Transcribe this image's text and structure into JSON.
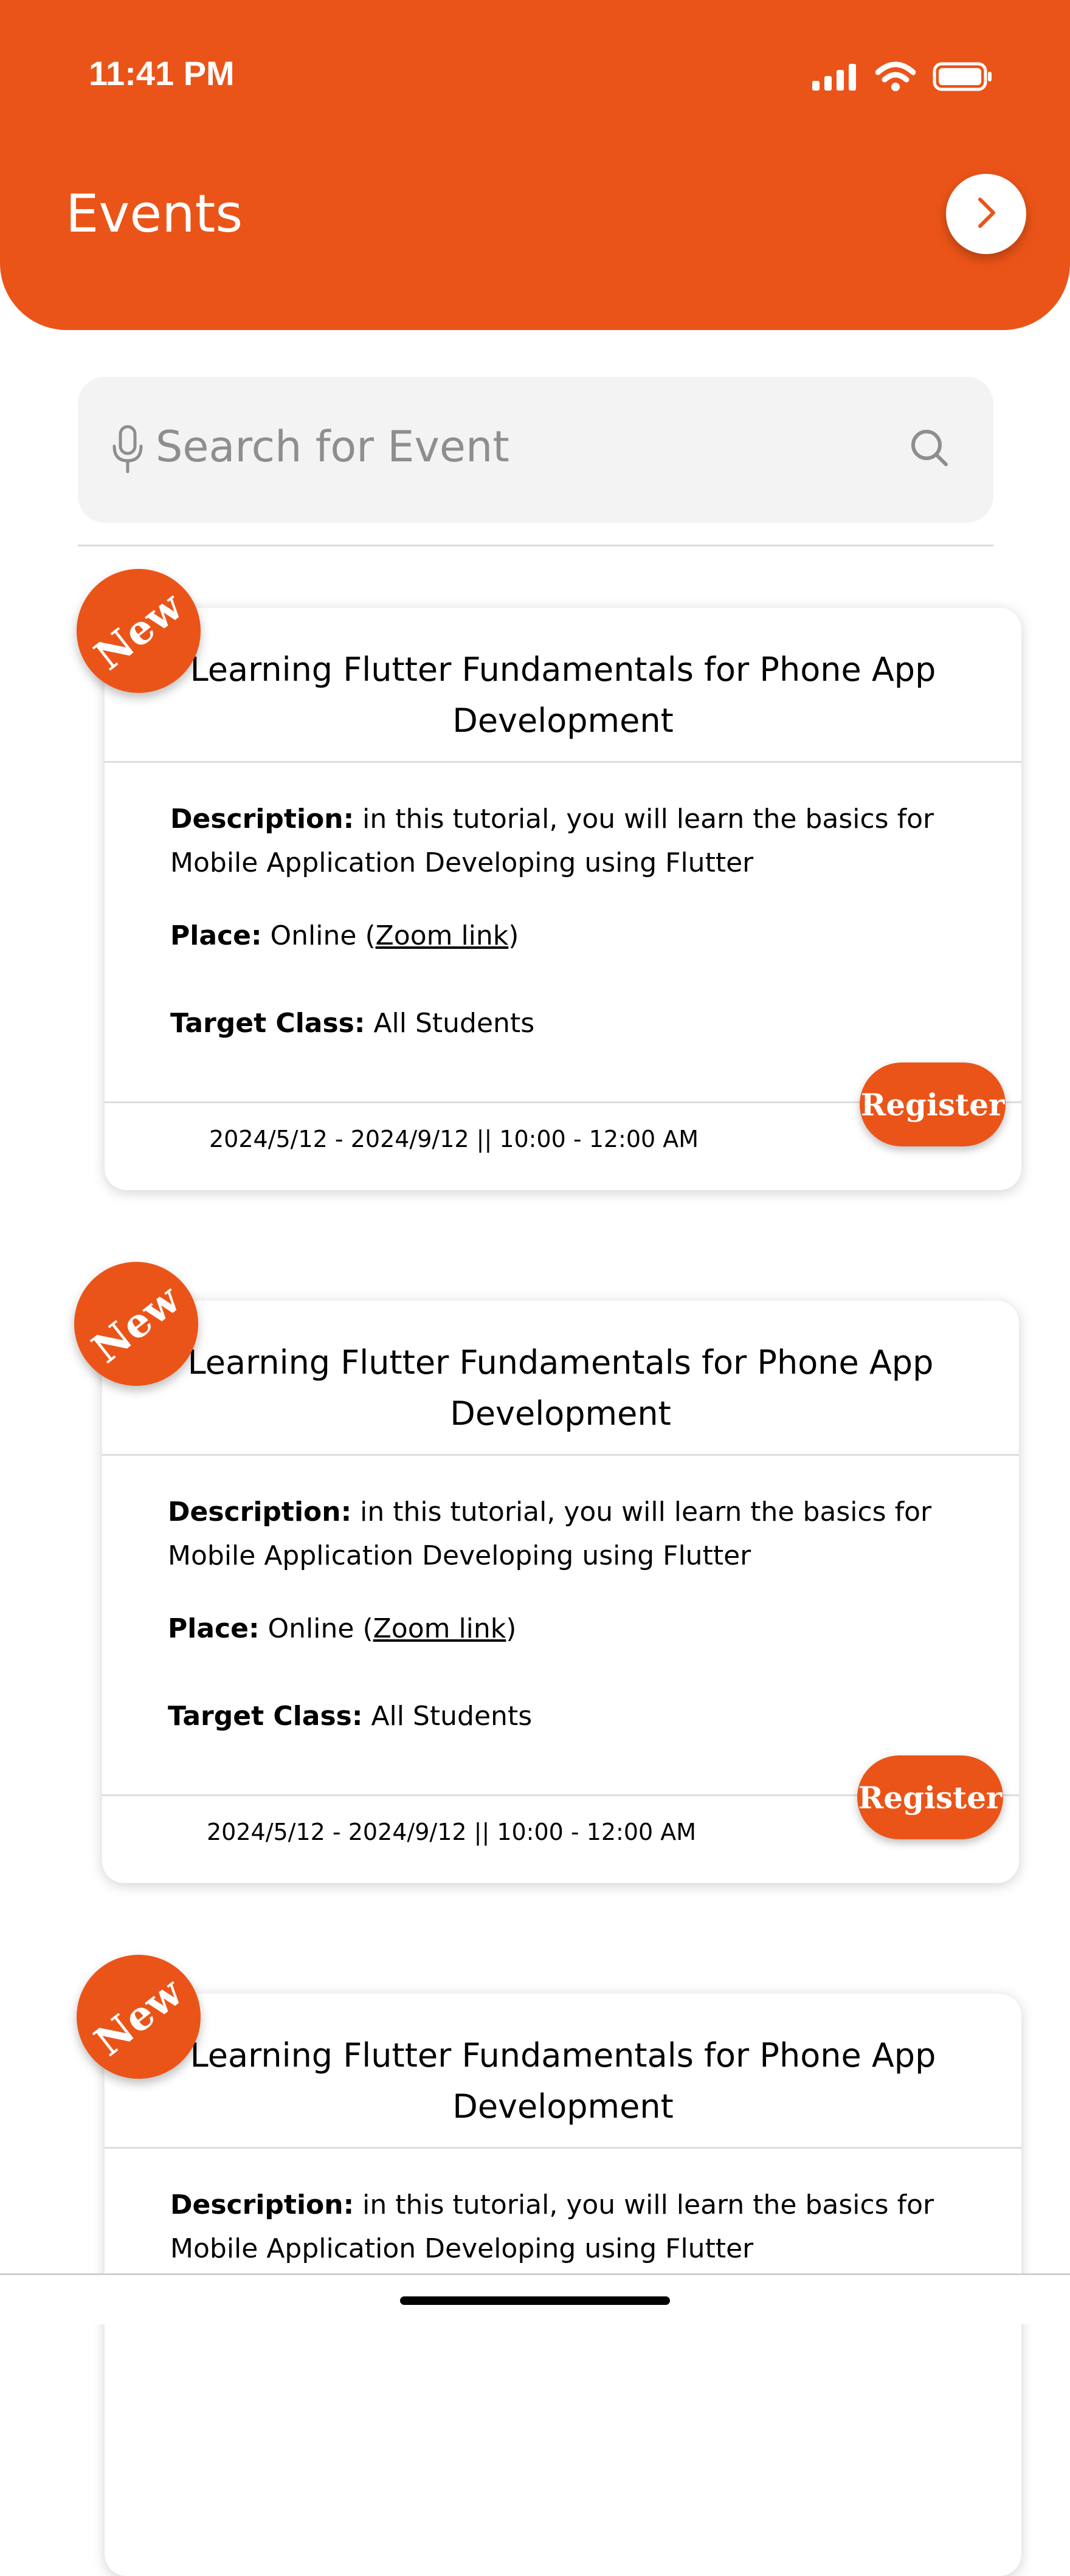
{
  "status_bar": {
    "time": "11:41 PM",
    "icons": [
      "signal-icon",
      "wifi-icon",
      "battery-icon"
    ]
  },
  "header": {
    "title": "Events",
    "next_icon": "chevron-right-icon"
  },
  "search": {
    "placeholder": "Search for Event",
    "icons": [
      "microphone-icon",
      "search-icon"
    ]
  },
  "colors": {
    "accent": "#EB5418",
    "search_bg": "#F3F3F3"
  },
  "events": [
    {
      "badge": "New",
      "title_line1": "Learning Flutter Fundamentals for Phone App",
      "title_line2": "Development",
      "description_label": "Description:",
      "description_line1": " in this tutorial, you will learn the basics for",
      "description_line2": "Mobile Application Developing using Flutter",
      "place_label": "Place:",
      "place_value_prefix": " Online (",
      "place_link": "Zoom  link",
      "place_value_suffix": ")",
      "target_label": "Target Class:",
      "target_value": " All Students",
      "date": "2024/5/12 - 2024/9/12  ||  10:00  - 12:00 AM",
      "register_label": "Register"
    },
    {
      "badge": "New",
      "title_line1": "Learning Flutter Fundamentals for Phone App",
      "title_line2": "Development",
      "description_label": "Description:",
      "description_line1": " in this tutorial, you will learn the basics for",
      "description_line2": "Mobile Application Developing using Flutter",
      "place_label": "Place:",
      "place_value_prefix": " Online (",
      "place_link": "Zoom  link",
      "place_value_suffix": ")",
      "target_label": "Target Class:",
      "target_value": " All Students",
      "date": "2024/5/12 - 2024/9/12  ||  10:00  - 12:00 AM",
      "register_label": "Register"
    },
    {
      "badge": "New",
      "title_line1": "Learning Flutter Fundamentals for Phone App",
      "title_line2": "Development",
      "description_label": "Description:",
      "description_line1": " in this tutorial, you will learn the basics for",
      "description_line2": "Mobile Application Developing using Flutter"
    }
  ]
}
